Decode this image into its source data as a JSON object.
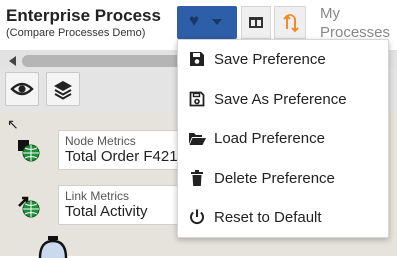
{
  "header": {
    "title": "Enterprise Process",
    "subtitle": "(Compare Processes Demo)",
    "my_processes": "My Processes"
  },
  "icons": {
    "preferences": "heart-icon",
    "preferences_caret": "caret-down-icon",
    "layout": "window-layout-icon",
    "sync": "sync-arrows-icon",
    "eye": "eye-icon",
    "layers": "layers-icon"
  },
  "metrics": {
    "node": {
      "label": "Node Metrics",
      "value": "Total Order F421"
    },
    "link": {
      "label": "Link Metrics",
      "value": "Total Activity"
    }
  },
  "menu": {
    "items": [
      {
        "label": "Save Preference",
        "icon": "floppy-disk-icon"
      },
      {
        "label": "Save As Preference",
        "icon": "floppy-disk-outline-icon"
      },
      {
        "label": "Load Preference",
        "icon": "folder-open-icon"
      },
      {
        "label": "Delete Preference",
        "icon": "trash-icon"
      },
      {
        "label": "Reset to Default",
        "icon": "power-icon"
      }
    ]
  },
  "colors": {
    "accent": "#2c5fa8",
    "sync_orange": "#f28c28",
    "canvas_bg": "#e6e3dc",
    "globe_green": "#1f8f3a"
  }
}
